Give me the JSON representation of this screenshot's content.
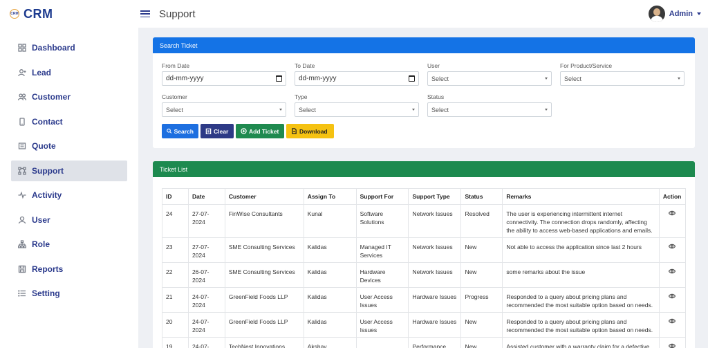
{
  "app": {
    "logo_text": "CRM",
    "name": "CRM"
  },
  "header": {
    "title": "Support",
    "user_name": "Admin"
  },
  "sidebar": {
    "items": [
      {
        "label": "Dashboard",
        "icon": "grid-icon"
      },
      {
        "label": "Lead",
        "icon": "user-plus-icon"
      },
      {
        "label": "Customer",
        "icon": "users-icon"
      },
      {
        "label": "Contact",
        "icon": "phone-icon"
      },
      {
        "label": "Quote",
        "icon": "document-icon"
      },
      {
        "label": "Support",
        "icon": "network-icon",
        "active": true
      },
      {
        "label": "Activity",
        "icon": "pulse-icon"
      },
      {
        "label": "User",
        "icon": "user-icon"
      },
      {
        "label": "Role",
        "icon": "hierarchy-icon"
      },
      {
        "label": "Reports",
        "icon": "save-icon"
      },
      {
        "label": "Setting",
        "icon": "list-icon"
      }
    ]
  },
  "search": {
    "heading": "Search Ticket",
    "from_date": {
      "label": "From Date",
      "value": "dd-mm-yyyy"
    },
    "to_date": {
      "label": "To Date",
      "value": "dd-mm-yyyy"
    },
    "user": {
      "label": "User",
      "value": "Select"
    },
    "product": {
      "label": "For Product/Service",
      "value": "Select"
    },
    "customer": {
      "label": "Customer",
      "value": "Select"
    },
    "type": {
      "label": "Type",
      "value": "Select"
    },
    "status": {
      "label": "Status",
      "value": "Select"
    },
    "buttons": {
      "search": "Search",
      "clear": "Clear",
      "add": "Add Ticket",
      "download": "Download"
    }
  },
  "tickets": {
    "heading": "Ticket List",
    "columns": [
      "ID",
      "Date",
      "Customer",
      "Assign To",
      "Support For",
      "Support Type",
      "Status",
      "Remarks",
      "Action"
    ],
    "rows": [
      {
        "id": "24",
        "date": "27-07-2024",
        "customer": "FinWise Consultants",
        "assign": "Kunal",
        "support_for": "Software Solutions",
        "type": "Network Issues",
        "status": "Resolved",
        "remarks": "The user is experiencing intermittent internet connectivity. The connection drops randomly, affecting the ability to access web-based applications and emails."
      },
      {
        "id": "23",
        "date": "27-07-2024",
        "customer": "SME Consulting Services",
        "assign": "Kalidas",
        "support_for": "Managed IT Services",
        "type": "Network Issues",
        "status": "New",
        "remarks": "Not able to access the application since last 2 hours"
      },
      {
        "id": "22",
        "date": "26-07-2024",
        "customer": "SME Consulting Services",
        "assign": "Kalidas",
        "support_for": "Hardware Devices",
        "type": "Network Issues",
        "status": "New",
        "remarks": "some remarks about the issue"
      },
      {
        "id": "21",
        "date": "24-07-2024",
        "customer": "GreenField Foods LLP",
        "assign": "Kalidas",
        "support_for": "User Access Issues",
        "type": "Hardware Issues",
        "status": "Progress",
        "remarks": "Responded to a query about pricing plans and recommended the most suitable option based on needs."
      },
      {
        "id": "20",
        "date": "24-07-2024",
        "customer": "GreenField Foods LLP",
        "assign": "Kalidas",
        "support_for": "User Access Issues",
        "type": "Hardware Issues",
        "status": "New",
        "remarks": "Responded to a query about pricing plans and recommended the most suitable option based on needs."
      },
      {
        "id": "19",
        "date": "24-07-",
        "customer": "TechNest Innovations",
        "assign": "Akshay",
        "support_for": "",
        "type": "Performance",
        "status": "New",
        "remarks": "Assisted customer with a warranty claim for a defective"
      }
    ]
  }
}
